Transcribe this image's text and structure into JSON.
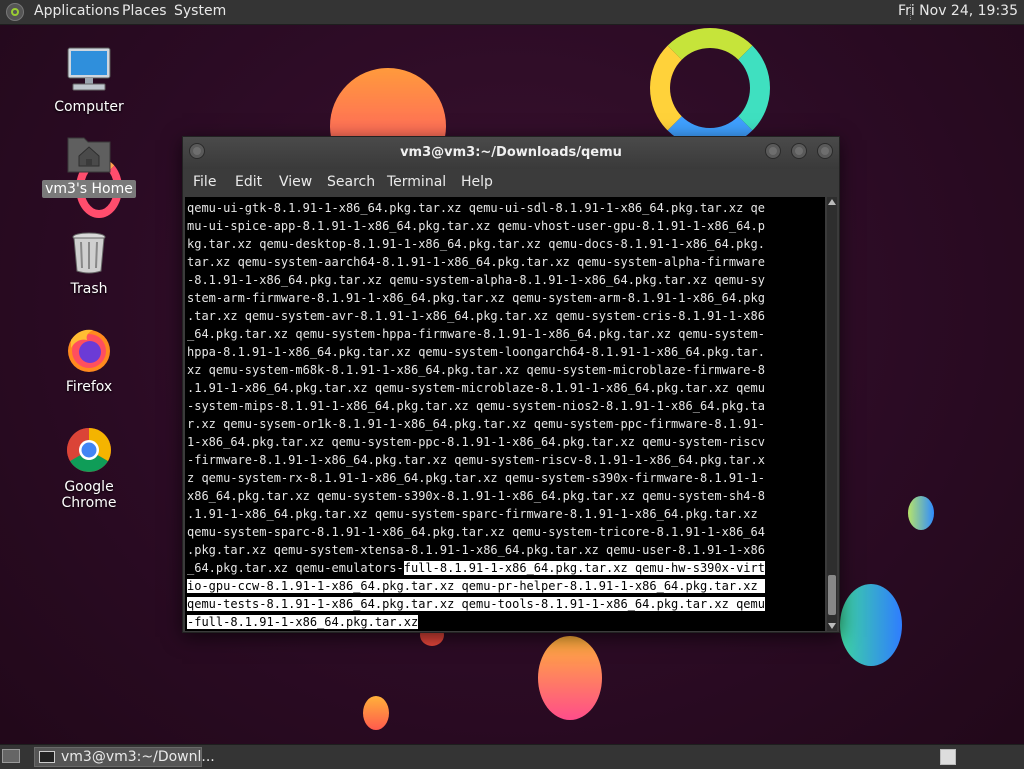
{
  "top_panel": {
    "menus": [
      "Applications",
      "Places",
      "System"
    ],
    "clock": "Fri Nov 24, 19:35"
  },
  "desktop": {
    "icons": [
      {
        "label": "Computer",
        "icon": "computer-icon"
      },
      {
        "label": "vm3's Home",
        "icon": "home-folder-icon",
        "selected": true
      },
      {
        "label": "Trash",
        "icon": "trash-icon"
      },
      {
        "label": "Firefox",
        "icon": "firefox-icon"
      },
      {
        "label": "Google Chrome",
        "icon": "chrome-icon"
      }
    ]
  },
  "terminal": {
    "title": "vm3@vm3:~/Downloads/qemu",
    "menu": [
      "File",
      "Edit",
      "View",
      "Search",
      "Terminal",
      "Help"
    ],
    "lines": [
      "qemu-ui-gtk-8.1.91-1-x86_64.pkg.tar.xz qemu-ui-sdl-8.1.91-1-x86_64.pkg.tar.xz qe",
      "mu-ui-spice-app-8.1.91-1-x86_64.pkg.tar.xz qemu-vhost-user-gpu-8.1.91-1-x86_64.p",
      "kg.tar.xz qemu-desktop-8.1.91-1-x86_64.pkg.tar.xz qemu-docs-8.1.91-1-x86_64.pkg.",
      "tar.xz qemu-system-aarch64-8.1.91-1-x86_64.pkg.tar.xz qemu-system-alpha-firmware",
      "-8.1.91-1-x86_64.pkg.tar.xz qemu-system-alpha-8.1.91-1-x86_64.pkg.tar.xz qemu-sy",
      "stem-arm-firmware-8.1.91-1-x86_64.pkg.tar.xz qemu-system-arm-8.1.91-1-x86_64.pkg",
      ".tar.xz qemu-system-avr-8.1.91-1-x86_64.pkg.tar.xz qemu-system-cris-8.1.91-1-x86",
      "_64.pkg.tar.xz qemu-system-hppa-firmware-8.1.91-1-x86_64.pkg.tar.xz qemu-system-",
      "hppa-8.1.91-1-x86_64.pkg.tar.xz qemu-system-loongarch64-8.1.91-1-x86_64.pkg.tar.",
      "xz qemu-system-m68k-8.1.91-1-x86_64.pkg.tar.xz qemu-system-microblaze-firmware-8",
      ".1.91-1-x86_64.pkg.tar.xz qemu-system-microblaze-8.1.91-1-x86_64.pkg.tar.xz qemu",
      "-system-mips-8.1.91-1-x86_64.pkg.tar.xz qemu-system-nios2-8.1.91-1-x86_64.pkg.ta",
      "r.xz qemu-sysem-or1k-8.1.91-1-x86_64.pkg.tar.xz qemu-system-ppc-firmware-8.1.91-",
      "1-x86_64.pkg.tar.xz qemu-system-ppc-8.1.91-1-x86_64.pkg.tar.xz qemu-system-riscv",
      "-firmware-8.1.91-1-x86_64.pkg.tar.xz qemu-system-riscv-8.1.91-1-x86_64.pkg.tar.x",
      "z qemu-system-rx-8.1.91-1-x86_64.pkg.tar.xz qemu-system-s390x-firmware-8.1.91-1-",
      "x86_64.pkg.tar.xz qemu-system-s390x-8.1.91-1-x86_64.pkg.tar.xz qemu-system-sh4-8",
      ".1.91-1-x86_64.pkg.tar.xz qemu-system-sparc-firmware-8.1.91-1-x86_64.pkg.tar.xz",
      "qemu-system-sparc-8.1.91-1-x86_64.pkg.tar.xz qemu-system-tricore-8.1.91-1-x86_64",
      ".pkg.tar.xz qemu-system-xtensa-8.1.91-1-x86_64.pkg.tar.xz qemu-user-8.1.91-1-x86",
      "_64.pkg.tar.xz qemu-emulators-"
    ],
    "selected_tail_first": "full-8.1.91-1-x86_64.pkg.tar.xz qemu-hw-s390x-virt",
    "selected_lines": [
      "io-gpu-ccw-8.1.91-1-x86_64.pkg.tar.xz qemu-pr-helper-8.1.91-1-x86_64.pkg.tar.xz ",
      "qemu-tests-8.1.91-1-x86_64.pkg.tar.xz qemu-tools-8.1.91-1-x86_64.pkg.tar.xz qemu"
    ],
    "last_line_selected": "-full-8.1.91-1-x86_64.pkg.tar.x",
    "last_line_cursor_char": "z"
  },
  "bottom_panel": {
    "task_label": "vm3@vm3:~/Downl..."
  }
}
